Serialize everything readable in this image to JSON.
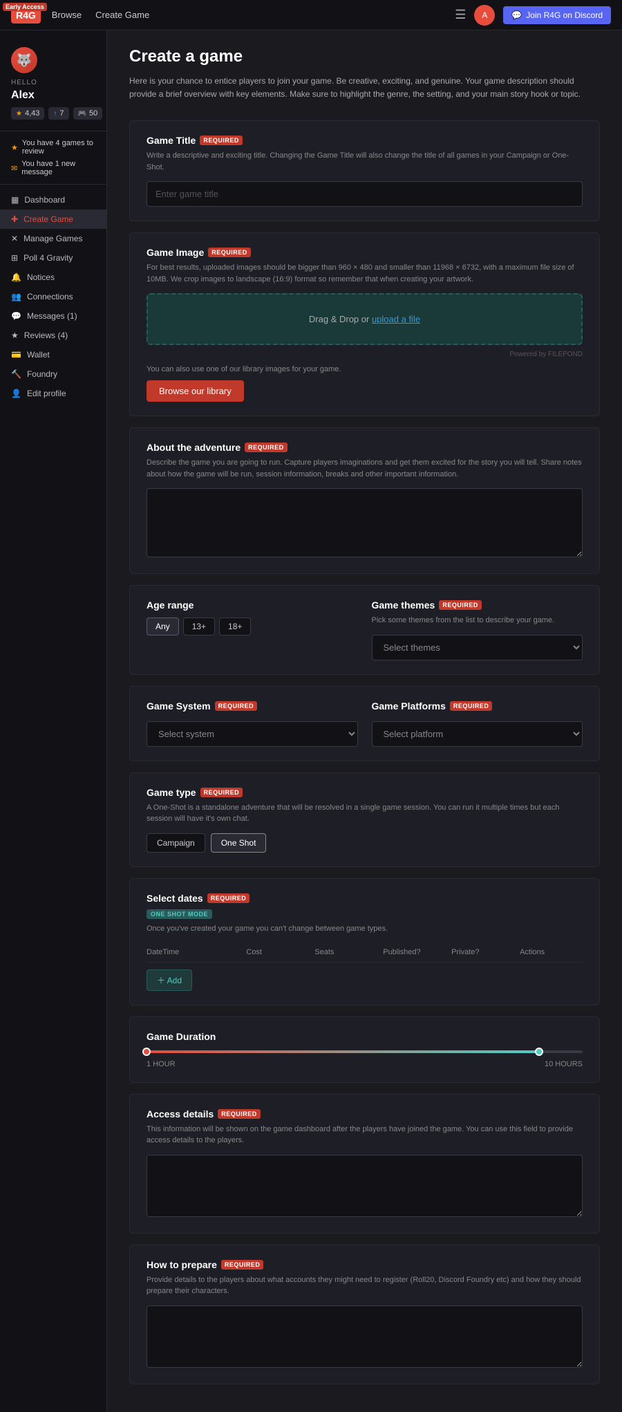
{
  "header": {
    "early_access_label": "Early Access",
    "logo_text": "R4G",
    "nav": [
      {
        "label": "Browse",
        "href": "#"
      },
      {
        "label": "Create Game",
        "href": "#"
      }
    ],
    "join_discord_label": "Join R4G on Discord",
    "discord_icon": "💬"
  },
  "sidebar": {
    "hello_label": "HELLO",
    "username": "Alex",
    "stats": [
      {
        "icon": "★",
        "value": "4,43",
        "type": "star"
      },
      {
        "icon": "↑",
        "value": "7",
        "type": "blue"
      },
      {
        "icon": "🎮",
        "value": "50",
        "type": "green"
      }
    ],
    "notices": [
      {
        "icon": "★",
        "text": "You have 4 games to review"
      },
      {
        "icon": "✉",
        "text": "You have 1 new message"
      }
    ],
    "nav_items": [
      {
        "id": "dashboard",
        "icon": "▦",
        "label": "Dashboard"
      },
      {
        "id": "create-game",
        "icon": "✚",
        "label": "Create Game",
        "active": true
      },
      {
        "id": "manage-games",
        "icon": "✕",
        "label": "Manage Games"
      },
      {
        "id": "poll4gravity",
        "icon": "⊞",
        "label": "Poll 4 Gravity"
      },
      {
        "id": "notices",
        "icon": "🔔",
        "label": "Notices"
      },
      {
        "id": "connections",
        "icon": "👥",
        "label": "Connections"
      },
      {
        "id": "messages",
        "icon": "💬",
        "label": "Messages (1)"
      },
      {
        "id": "reviews",
        "icon": "★",
        "label": "Reviews (4)"
      },
      {
        "id": "wallet",
        "icon": "💳",
        "label": "Wallet"
      },
      {
        "id": "foundry",
        "icon": "🔨",
        "label": "Foundry"
      },
      {
        "id": "edit-profile",
        "icon": "👤",
        "label": "Edit profile"
      }
    ]
  },
  "main": {
    "page_title": "Create a game",
    "page_subtitle": "Here is your chance to entice players to join your game. Be creative, exciting, and genuine. Your game description should provide a brief overview with key elements. Make sure to highlight the genre, the setting, and your main story hook or topic.",
    "sections": {
      "game_title": {
        "label": "Game Title",
        "required": "REQUIRED",
        "desc": "Write a descriptive and exciting title. Changing the Game Title will also change the title of all games in your Campaign or One-Shot.",
        "placeholder": "Enter game title"
      },
      "game_image": {
        "label": "Game Image",
        "required": "REQUIRED",
        "desc": "For best results, uploaded images should be bigger than 960 × 480 and smaller than 11968 × 6732, with a maximum file size of 10MB. We crop images to landscape (16:9) format so remember that when creating your artwork.",
        "dropzone_text": "Drag & Drop or ",
        "dropzone_link": "upload a file",
        "powered_by": "Powered by FILEPOND",
        "library_note": "You can also use one of our library images for your game.",
        "browse_library_btn": "Browse our library"
      },
      "about": {
        "label": "About the adventure",
        "required": "REQUIRED",
        "desc": "Describe the game you are going to run. Capture players imaginations and get them excited for the story you will tell. Share notes about how the game will be run, session information, breaks and other important information."
      },
      "age_range": {
        "label": "Age range",
        "buttons": [
          {
            "label": "Any",
            "active": true
          },
          {
            "label": "13+",
            "active": false
          },
          {
            "label": "18+",
            "active": false
          }
        ]
      },
      "game_themes": {
        "label": "Game themes",
        "required": "REQUIRED",
        "desc": "Pick some themes from the list to describe your game.",
        "select_placeholder": "Select themes"
      },
      "game_system": {
        "label": "Game System",
        "required": "REQUIRED",
        "select_placeholder": "Select system"
      },
      "game_platforms": {
        "label": "Game Platforms",
        "required": "REQUIRED",
        "select_placeholder": "Select platform"
      },
      "game_type": {
        "label": "Game type",
        "required": "REQUIRED",
        "desc": "A One-Shot is a standalone adventure that will be resolved in a single game session. You can run it multiple times but each session will have it's own chat.",
        "buttons": [
          {
            "label": "Campaign",
            "active": false
          },
          {
            "label": "One Shot",
            "active": true
          }
        ]
      },
      "select_dates": {
        "label": "Select dates",
        "required": "REQUIRED",
        "mode_badge": "ONE  SHOT  MODE",
        "notice": "Once you've created your game you can't change between game types.",
        "table_headers": [
          "DateTime",
          "Cost",
          "Seats",
          "Published?",
          "Private?",
          "Actions"
        ],
        "add_btn": "＋  Add"
      },
      "game_duration": {
        "label": "Game Duration",
        "min_label": "1  HOUR",
        "max_label": "10  HOURS"
      },
      "access_details": {
        "label": "Access details",
        "required": "REQUIRED",
        "desc": "This information will be shown on the game dashboard after the players have joined the game. You can use this field to provide access details to the players."
      },
      "how_to_prepare": {
        "label": "How to prepare",
        "required": "REQUIRED",
        "desc": "Provide details to the players about what accounts they might need to register (Roll20, Discord Foundry etc) and how they should prepare their characters."
      }
    }
  }
}
